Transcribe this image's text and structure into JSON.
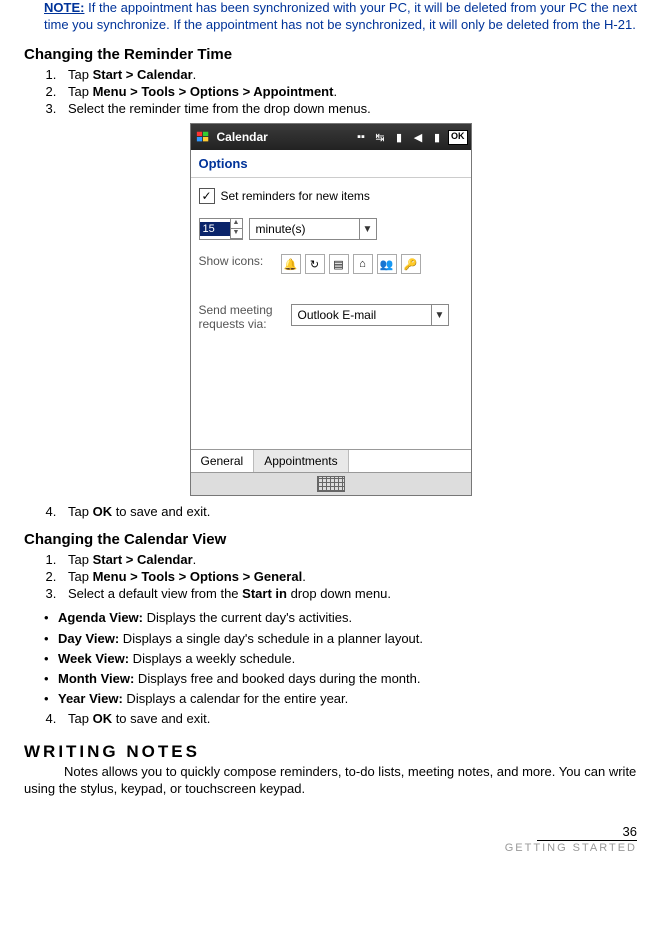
{
  "note": {
    "label": "NOTE:",
    "text": " If the appointment has been synchronized with your PC, it will be deleted from your PC the next time you synchronize. If the appointment has not be synchronized, it will only be deleted from the H-21."
  },
  "reminder": {
    "heading": "Changing the Reminder Time",
    "steps": {
      "s1a": "Tap ",
      "s1b": "Start > Calendar",
      "s1c": ".",
      "s2a": "Tap ",
      "s2b": "Menu > Tools > Options > Appointment",
      "s2c": ".",
      "s3": "Select the reminder time from the drop down menus.",
      "s4a": "Tap ",
      "s4b": "OK",
      "s4c": " to save and exit."
    }
  },
  "device": {
    "title": "Calendar",
    "ok": "OK",
    "options": "Options",
    "checkbox_label": "Set reminders for new items",
    "num_value": "15",
    "unit": "minute(s)",
    "show_icons_label": "Show icons:",
    "send_label_l1": "Send meeting",
    "send_label_l2": "requests via:",
    "send_value": "Outlook E-mail",
    "tab_general": "General",
    "tab_appt": "Appointments"
  },
  "calview": {
    "heading": "Changing the Calendar View",
    "steps": {
      "s1a": "Tap ",
      "s1b": "Start > Calendar",
      "s1c": ".",
      "s2a": "Tap ",
      "s2b": "Menu > Tools > Options > General",
      "s2c": ".",
      "s3a": "Select a default view from the ",
      "s3b": "Start in",
      "s3c": " drop down menu.",
      "s4a": "Tap ",
      "s4b": "OK",
      "s4c": " to save and exit."
    },
    "bullets": {
      "b1a": "Agenda View:",
      "b1b": " Displays the current day's activities.",
      "b2a": "Day View:",
      "b2b": " Displays a single day's schedule in a planner layout.",
      "b3a": "Week View:",
      "b3b": " Displays a weekly schedule.",
      "b4a": "Month View:",
      "b4b": " Displays free and booked days during the month.",
      "b5a": "Year View:",
      "b5b": " Displays a calendar for the entire year."
    }
  },
  "writing": {
    "heading": "Writing Notes",
    "para": "Notes allows you to quickly compose reminders, to-do lists, meeting notes, and more. You can write using the stylus, keypad, or touchscreen keypad."
  },
  "footer": {
    "page": "36",
    "section": "Getting Started"
  }
}
